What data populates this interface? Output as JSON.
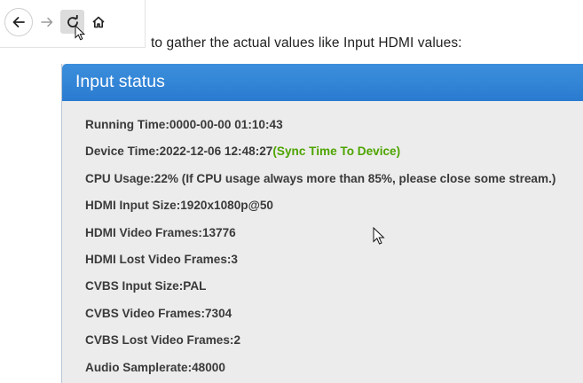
{
  "caption": "to gather the actual values like Input HDMI values:",
  "panel": {
    "title": "Input status"
  },
  "status": {
    "running_time": "Running Time:0000-00-00 01:10:43",
    "device_time": "Device Time:2022-12-06 12:48:27",
    "sync_link": "(Sync Time To Device)",
    "cpu_usage": "CPU Usage:22% (If CPU usage always more than 85%, please close some stream.)",
    "hdmi_input_size": "HDMI Input Size:1920x1080p@50",
    "hdmi_video_frames": "HDMI Video Frames:13776",
    "hdmi_lost_frames": "HDMI Lost Video Frames:3",
    "cvbs_input_size": "CVBS Input Size:PAL",
    "cvbs_video_frames": "CVBS Video Frames:7304",
    "cvbs_lost_frames": "CVBS Lost Video Frames:2",
    "audio_samplerate": "Audio Samplerate:48000"
  },
  "icons": {
    "back": "arrow-left-icon",
    "forward": "arrow-right-icon",
    "reload": "reload-icon",
    "home": "home-icon",
    "cursor": "mouse-pointer-icon"
  },
  "colors": {
    "header": "#2f85d6",
    "panel_bg": "#ececec",
    "text": "#3a3a3a",
    "link": "#4ea400"
  }
}
